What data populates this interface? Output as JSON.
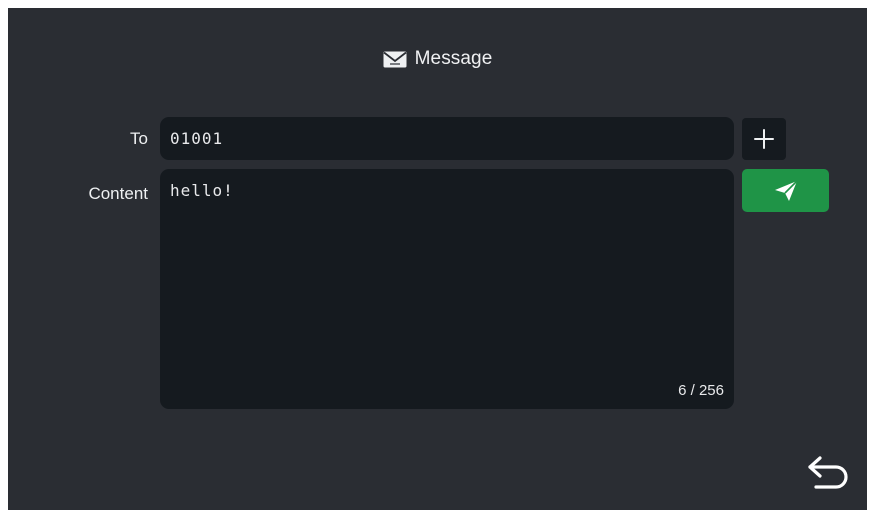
{
  "header": {
    "title": "Message",
    "icon": "envelope-icon"
  },
  "form": {
    "to_label": "To",
    "to_value": "01001",
    "content_label": "Content",
    "content_value": "hello!",
    "char_counter": "6 / 256"
  },
  "actions": {
    "add_icon": "plus-icon",
    "send_icon": "paper-plane-icon",
    "back_icon": "return-arrow-icon"
  },
  "colors": {
    "background": "#2a2d33",
    "field_background": "#151a1f",
    "send_button": "#1f9447",
    "text": "#e8e9eb"
  }
}
